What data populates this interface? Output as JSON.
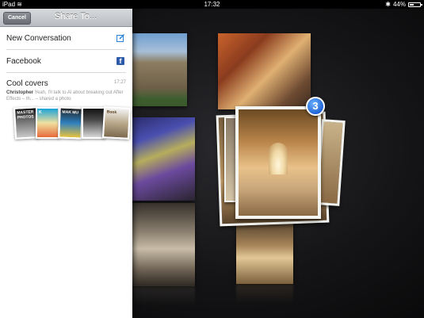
{
  "status_bar": {
    "device": "iPad",
    "time": "17:32",
    "battery": "44%",
    "battery_level": 0.44
  },
  "share_panel": {
    "cancel_label": "Cancel",
    "title": "Share To...",
    "options": [
      {
        "label": "New Conversation",
        "icon": "compose-icon"
      },
      {
        "label": "Facebook",
        "icon": "facebook-icon",
        "icon_glyph": "f"
      }
    ],
    "conversation": {
      "title": "Cool covers",
      "time": "17:27",
      "sender": "Christopher",
      "preview_text": "Yeah, I'll talk to Al about breaking out After Effects – th... – shared a photo",
      "thumbnails": [
        {
          "label": "MASTER PHOTOS"
        },
        {
          "label": "K"
        },
        {
          "label": "MAK MU"
        },
        {
          "label": ""
        },
        {
          "label": "Book"
        }
      ]
    }
  },
  "photo_stack": {
    "badge_count": "3"
  },
  "colors": {
    "accent_blue": "#1f63d6",
    "facebook_blue": "#2f5ca8",
    "compose_blue": "#2a7fd4"
  }
}
